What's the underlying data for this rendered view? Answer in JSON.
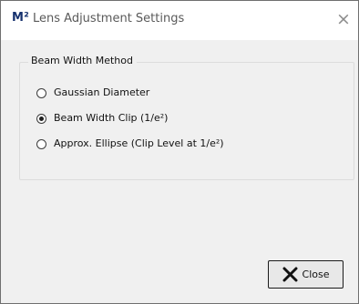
{
  "window": {
    "app_icon_text": "M²",
    "title": "Lens Adjustment Settings",
    "close_glyph": "×"
  },
  "group": {
    "title": "Beam Width Method",
    "options": [
      {
        "label": "Gaussian Diameter",
        "checked": false
      },
      {
        "label": "Beam Width Clip (1/e²)",
        "checked": true
      },
      {
        "label": "Approx. Ellipse (Clip Level at 1/e²)",
        "checked": false
      }
    ]
  },
  "buttons": {
    "close_label": "Close",
    "close_icon": "x-icon"
  },
  "colors": {
    "app_icon": "#16316e",
    "window_bg": "#f0f0f0",
    "titlebar_bg": "#ffffff"
  }
}
